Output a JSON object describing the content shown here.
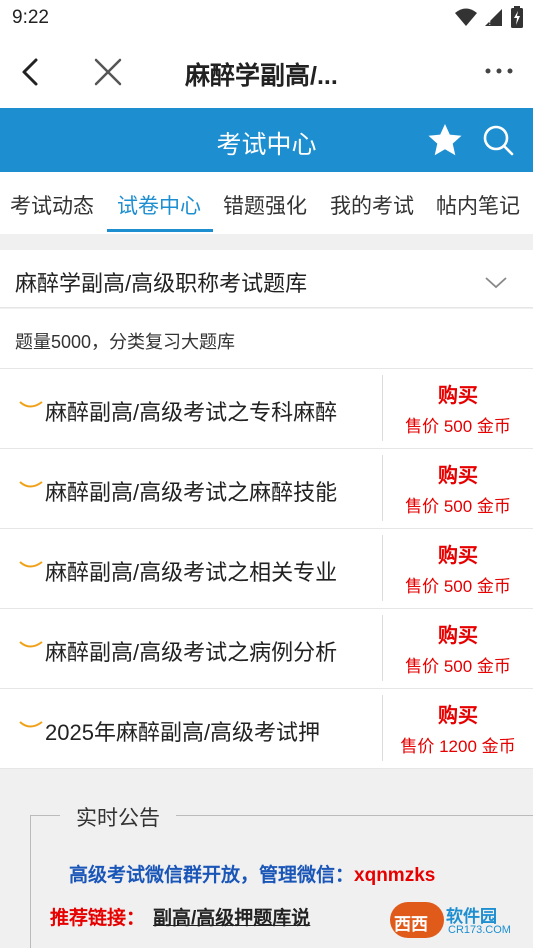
{
  "status_bar": {
    "time": "9:22"
  },
  "nav": {
    "title": "麻醉学副高/..."
  },
  "header": {
    "title": "考试中心"
  },
  "tabs": [
    {
      "label": "考试动态",
      "active": false
    },
    {
      "label": "试卷中心",
      "active": true
    },
    {
      "label": "错题强化",
      "active": false
    },
    {
      "label": "我的考试",
      "active": false
    },
    {
      "label": "帖内笔记",
      "active": false
    }
  ],
  "bank": {
    "title": "麻醉学副高/高级职称考试题库",
    "description": "题量5000，分类复习大题库"
  },
  "items": [
    {
      "title": "麻醉副高/高级考试之专科麻醉",
      "buy_label": "购买",
      "price": "售价 500 金币"
    },
    {
      "title": "麻醉副高/高级考试之麻醉技能",
      "buy_label": "购买",
      "price": "售价 500 金币"
    },
    {
      "title": "麻醉副高/高级考试之相关专业",
      "buy_label": "购买",
      "price": "售价 500 金币"
    },
    {
      "title": "麻醉副高/高级考试之病例分析",
      "buy_label": "购买",
      "price": "售价 500 金币"
    },
    {
      "title": "2025年麻醉副高/高级考试押",
      "buy_label": "购买",
      "price": "售价 1200 金币"
    }
  ],
  "notice": {
    "title": "实时公告",
    "line1_text": "高级考试微信群开放，管理微信：",
    "line1_wechat": "xqnmzks",
    "line2_label": "推荐链接：",
    "line2_link": "副高/高级押题库说"
  },
  "watermark": {
    "logo_text": "西西",
    "name": "软件园",
    "url": "CR173.COM"
  },
  "colors": {
    "accent": "#1d8fd1",
    "price_red": "#e60000",
    "notice_blue": "#1a56b8",
    "background": "#f0f0f0"
  }
}
